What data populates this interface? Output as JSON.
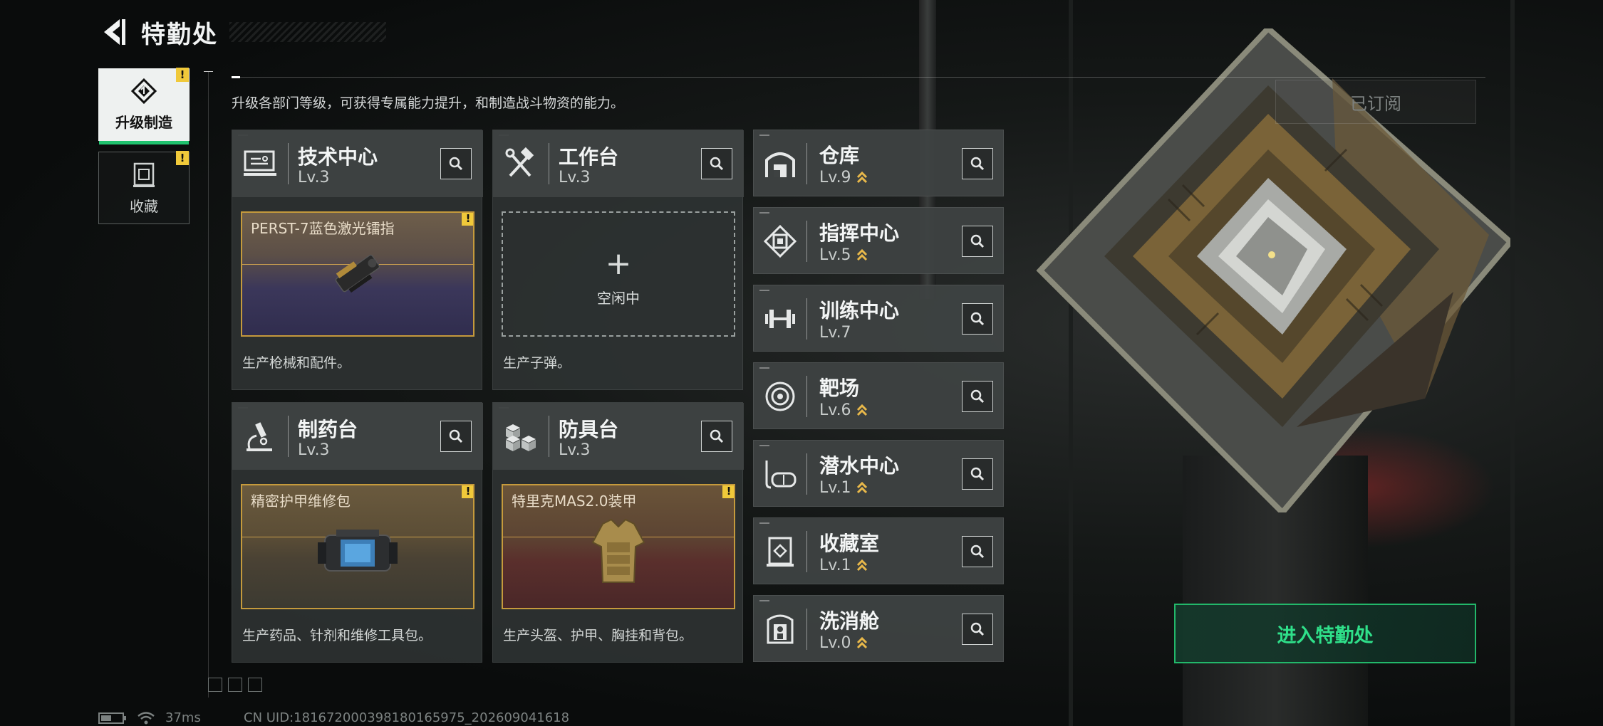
{
  "header": {
    "title": "特勤处"
  },
  "subtitle": "升级各部门等级，可获得专属能力提升，和制造战斗物资的能力。",
  "subscribed_label": "已订阅",
  "sidebar": {
    "items": [
      {
        "label": "升级制造",
        "alert": "!"
      },
      {
        "label": "收藏",
        "alert": "!"
      }
    ]
  },
  "big_cards": [
    {
      "name": "技术中心",
      "level": "Lv.3",
      "slot_name": "PERST-7蓝色激光镭指",
      "slot_alert": "!",
      "desc": "生产枪械和配件。"
    },
    {
      "name": "工作台",
      "level": "Lv.3",
      "slot_idle": "空闲中",
      "slot_plus": "+",
      "desc": "生产子弹。"
    },
    {
      "name": "制药台",
      "level": "Lv.3",
      "slot_name": "精密护甲维修包",
      "slot_alert": "!",
      "desc": "生产药品、针剂和维修工具包。"
    },
    {
      "name": "防具台",
      "level": "Lv.3",
      "slot_name": "特里克MAS2.0装甲",
      "slot_alert": "!",
      "desc": "生产头盔、护甲、胸挂和背包。"
    }
  ],
  "small_cards": [
    {
      "name": "仓库",
      "level": "Lv.9",
      "icon": "warehouse-icon"
    },
    {
      "name": "指挥中心",
      "level": "Lv.5",
      "icon": "chip-icon"
    },
    {
      "name": "训练中心",
      "level": "Lv.7",
      "icon": "dumbbell-icon"
    },
    {
      "name": "靶场",
      "level": "Lv.6",
      "icon": "target-icon"
    },
    {
      "name": "潜水中心",
      "level": "Lv.1",
      "icon": "diving-mask-icon"
    },
    {
      "name": "收藏室",
      "level": "Lv.1",
      "icon": "collection-icon"
    },
    {
      "name": "洗消舱",
      "level": "Lv.0",
      "icon": "decontamination-icon"
    }
  ],
  "enter_button": "进入特勤处",
  "footer": {
    "ping": "37ms",
    "uid": "CN UID:181672000398180165975_202609041618"
  },
  "colors": {
    "accent_green": "#2fe08a",
    "alert_yellow": "#f0c93a",
    "slot_gold": "#c59a3c",
    "level_chevron": "#e8b84a"
  }
}
